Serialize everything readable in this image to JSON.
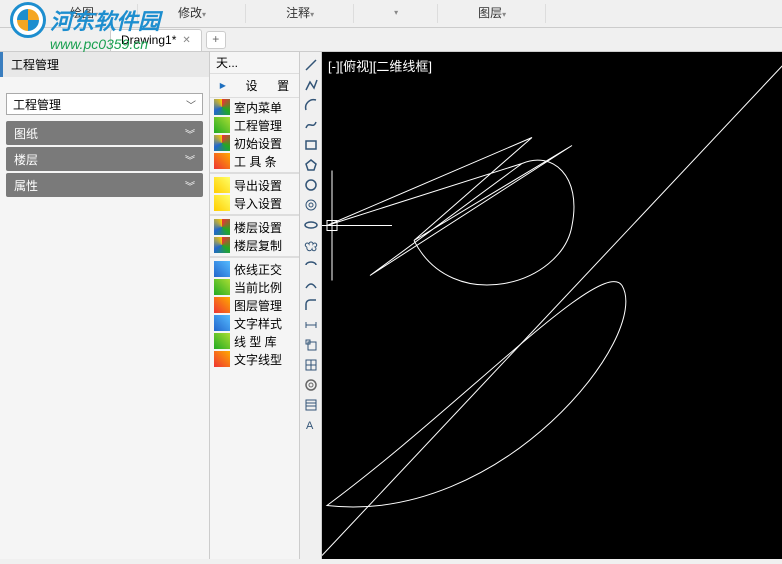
{
  "ribbon": {
    "tabs": [
      "绘图",
      "修改",
      "注释",
      "",
      "图层"
    ]
  },
  "documentTab": {
    "name": "Drawing1*",
    "addLabel": "+"
  },
  "watermark": {
    "brand": "河东软件园",
    "url": "www.pc0359.cn"
  },
  "leftPanel": {
    "title": "工程管理",
    "dropdown": "工程管理",
    "rows": [
      "图纸",
      "楼层",
      "属性"
    ]
  },
  "palette": {
    "header": "天...",
    "btnSet": "设",
    "btnAlign": "置",
    "items": [
      {
        "icon": "mix",
        "label": "室内菜单"
      },
      {
        "icon": "grn",
        "label": "工程管理"
      },
      {
        "icon": "mix",
        "label": "初始设置"
      },
      {
        "icon": "red",
        "label": "工 具 条"
      },
      {
        "icon": "yel",
        "label": "导出设置"
      },
      {
        "icon": "yel",
        "label": "导入设置"
      },
      {
        "icon": "mix",
        "label": "楼层设置"
      },
      {
        "icon": "mix",
        "label": "楼层复制"
      },
      {
        "icon": "blu",
        "label": "依线正交"
      },
      {
        "icon": "grn",
        "label": "当前比例"
      },
      {
        "icon": "red",
        "label": "图层管理"
      },
      {
        "icon": "blu",
        "label": "文字样式"
      },
      {
        "icon": "grn",
        "label": "线 型 库"
      },
      {
        "icon": "red",
        "label": "文字线型"
      }
    ]
  },
  "canvas": {
    "viewLabel": "[-][俯视][二维线框]"
  },
  "vtools": [
    "line",
    "pline",
    "arc",
    "spline",
    "rect",
    "poly",
    "circle",
    "donut",
    "ellipse",
    "cloud",
    "earc",
    "sweep",
    "fillet",
    "dim",
    "scale",
    "grid",
    "cam",
    "table",
    "text"
  ]
}
